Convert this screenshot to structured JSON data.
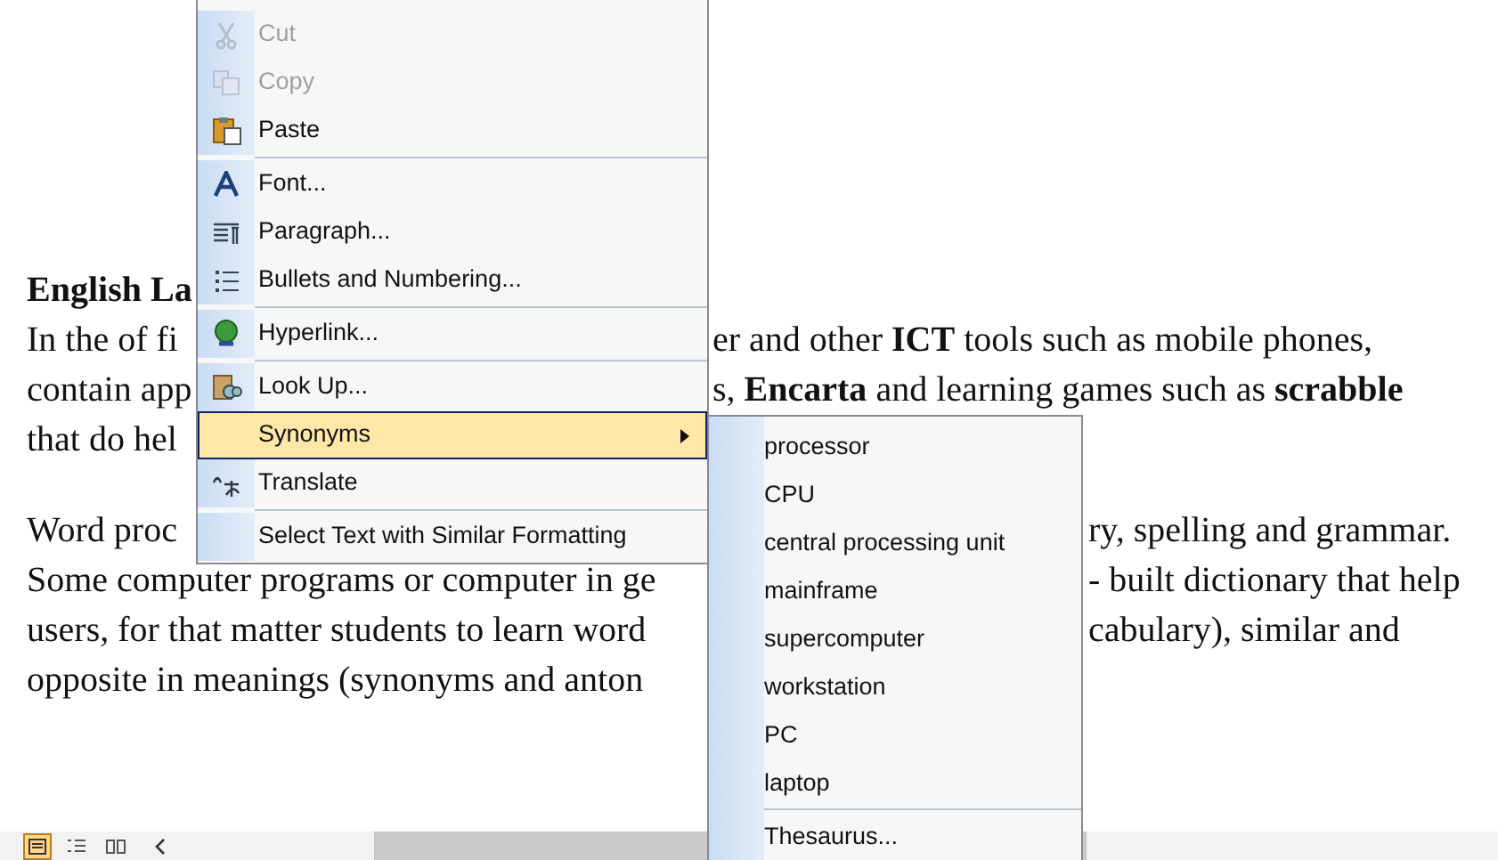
{
  "document": {
    "heading": "English La",
    "paragraphs": [
      {
        "lines": [
          {
            "left": "In the of fi",
            "right": "er and other **ICT** tools such as mobile phones,"
          },
          {
            "left": "contain app",
            "right": "s, **Encarta** and learning games such as **scrabble**"
          },
          {
            "left": "that do hel"
          }
        ]
      },
      {
        "lines": [
          {
            "left": "Word proc",
            "right": "ry, spelling and grammar."
          },
          {
            "left": "Some computer programs or computer in ge",
            "right": "- built dictionary that help"
          },
          {
            "left": "users, for that matter students to learn word",
            "right": "cabulary), similar and"
          },
          {
            "left": "opposite in meanings (synonyms and anton"
          }
        ]
      }
    ]
  },
  "context_menu": {
    "items": [
      {
        "label": "Cut",
        "disabled": true,
        "selected": false,
        "separator_above": false,
        "has_submenu": false
      },
      {
        "label": "Copy",
        "disabled": true,
        "selected": false,
        "separator_above": false,
        "has_submenu": false
      },
      {
        "label": "Paste",
        "disabled": false,
        "selected": false,
        "separator_above": false,
        "has_submenu": false
      },
      {
        "label": "Font...",
        "disabled": false,
        "selected": false,
        "separator_above": true,
        "has_submenu": false
      },
      {
        "label": "Paragraph...",
        "disabled": false,
        "selected": false,
        "separator_above": false,
        "has_submenu": false
      },
      {
        "label": "Bullets and Numbering...",
        "disabled": false,
        "selected": false,
        "separator_above": false,
        "has_submenu": false
      },
      {
        "label": "Hyperlink...",
        "disabled": false,
        "selected": false,
        "separator_above": true,
        "has_submenu": false
      },
      {
        "label": "Look Up...",
        "disabled": false,
        "selected": false,
        "separator_above": true,
        "has_submenu": false
      },
      {
        "label": "Synonyms",
        "disabled": false,
        "selected": true,
        "separator_above": false,
        "has_submenu": true
      },
      {
        "label": "Translate",
        "disabled": false,
        "selected": false,
        "separator_above": false,
        "has_submenu": false
      },
      {
        "label": "Select Text with Similar Formatting",
        "disabled": false,
        "selected": false,
        "separator_above": true,
        "has_submenu": false
      }
    ]
  },
  "synonyms_submenu": {
    "items": [
      {
        "label": "processor",
        "separator_above": false
      },
      {
        "label": "CPU",
        "separator_above": false
      },
      {
        "label": "central processing unit",
        "separator_above": false
      },
      {
        "label": "mainframe",
        "separator_above": false
      },
      {
        "label": "supercomputer",
        "separator_above": false
      },
      {
        "label": "workstation",
        "separator_above": false
      },
      {
        "label": "PC",
        "separator_above": false
      },
      {
        "label": "laptop",
        "separator_above": false
      },
      {
        "label": "Thesaurus...",
        "separator_above": true
      }
    ]
  },
  "status_bar": {
    "views": [
      {
        "selected": true
      },
      {
        "selected": false
      },
      {
        "selected": false
      }
    ]
  }
}
